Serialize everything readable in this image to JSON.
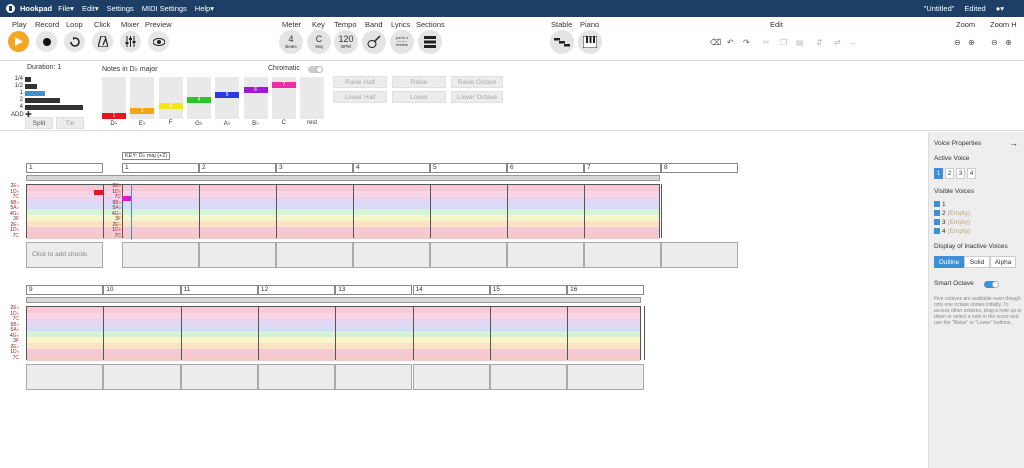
{
  "menubar": {
    "brand": "Hookpad",
    "items": [
      "File▾",
      "Edit▾",
      "Settings",
      "MIDI Settings",
      "Help▾"
    ],
    "doc_title": "\"Untitled\"",
    "doc_status": "Edited",
    "user": "▾"
  },
  "toolbar": {
    "labels": [
      "Play",
      "Record",
      "Loop",
      "Click",
      "Mixer",
      "Preview",
      "Meter",
      "Key",
      "Tempo",
      "Band",
      "Lyrics",
      "Sections",
      "Stable",
      "Piano",
      "Edit",
      "Zoom",
      "Zoom H"
    ],
    "meter": {
      "value": "4",
      "unit": "Beats"
    },
    "key": {
      "value": "C",
      "unit": "Maj"
    },
    "tempo": {
      "value": "120",
      "unit": "BPM"
    },
    "lyrics_preview": "you're a\n———\nbeeflow"
  },
  "duration": {
    "title": "Duration: 1",
    "labels": [
      "1/4",
      "1/2",
      "1",
      "2",
      "4",
      "ADD"
    ],
    "split": "Split",
    "tie": "Tie",
    "fills": [
      0.1,
      0.2,
      0.35,
      0.6,
      1.0,
      0
    ]
  },
  "notes": {
    "title": "Notes in D♭ major",
    "chromatic": "Chromatic",
    "items": [
      {
        "label": "D♭",
        "degree": "1",
        "color": "#e8141f",
        "level": 0
      },
      {
        "label": "E♭",
        "degree": "2",
        "color": "#f4a713",
        "level": 1
      },
      {
        "label": "F",
        "degree": "3",
        "color": "#f2e51a",
        "level": 2
      },
      {
        "label": "G♭",
        "degree": "4",
        "color": "#29c427",
        "level": 3
      },
      {
        "label": "A♭",
        "degree": "5",
        "color": "#2b3be0",
        "level": 4
      },
      {
        "label": "B♭",
        "degree": "6",
        "color": "#9b1cd6",
        "level": 5
      },
      {
        "label": "C",
        "degree": "7",
        "color": "#ef2aa6",
        "level": 6
      },
      {
        "label": "rest",
        "degree": "",
        "color": "#e9e9e9",
        "level": -1
      }
    ]
  },
  "transpose": {
    "raise_half": "Raise Half",
    "lower_half": "Lower Half",
    "raise": "Raise",
    "lower": "Lower",
    "raise_octave": "Raise Octave",
    "lower_octave": "Lower Octave"
  },
  "score": {
    "key_tag": "KEY: D♭ maj (+2)",
    "row1_measures": [
      "1",
      "2",
      "3",
      "4",
      "5",
      "6",
      "7",
      "8"
    ],
    "row2_measures": [
      "9",
      "10",
      "11",
      "12",
      "13",
      "14",
      "15",
      "16"
    ],
    "add_chords": "Click to add chords",
    "degrees_left": [
      "2",
      "1",
      "7",
      "6",
      "5",
      "4",
      "3",
      "2",
      "1",
      "7"
    ],
    "note_names_left": [
      "E♭",
      "D♭",
      "C",
      "B♭",
      "A♭",
      "G♭",
      "F",
      "E♭",
      "D♭",
      "C"
    ]
  },
  "side": {
    "title": "Voice Properties",
    "active_voice": "Active Voice",
    "voices": [
      "1",
      "2",
      "3",
      "4"
    ],
    "visible_voices": "Visible Voices",
    "visible_list": [
      {
        "n": "1",
        "note": ""
      },
      {
        "n": "2",
        "note": "(Empty)"
      },
      {
        "n": "3",
        "note": "(Empty)"
      },
      {
        "n": "4",
        "note": "(Empty)"
      }
    ],
    "display_inactive": "Display of Inactive Voices",
    "display_opts": [
      "Outline",
      "Solid",
      "Alpha"
    ],
    "smart_octave": "Smart Octave",
    "help": "Five octaves are available even though only one octave shows initially. To access other octaves, drag a note up or down or select a note in the score and use the \"Raise\" or \"Lower\" buttons."
  },
  "colors": {
    "navy": "#1d3f66",
    "accent": "#3d8fd6",
    "play": "#f6a623"
  }
}
